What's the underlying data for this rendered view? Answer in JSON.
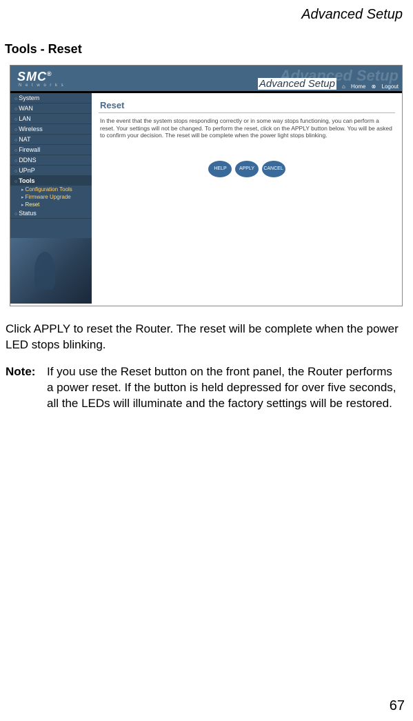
{
  "page": {
    "running_header": "Advanced Setup",
    "section_title": "Tools - Reset",
    "body_paragraph": "Click APPLY to reset the Router. The reset will be complete when the power LED stops blinking.",
    "note_label": "Note:",
    "note_text": "If you use the Reset button on the front panel, the Router performs a power reset. If the button is held depressed for over five seconds, all the LEDs will illuminate and the factory settings will be restored.",
    "page_number": "67"
  },
  "router_ui": {
    "logo_text": "SMC",
    "logo_reg": "®",
    "logo_sub": "N e t w o r k s",
    "banner_label": "Advanced Setup",
    "banner_ghost": "Advanced Setup",
    "header_links": {
      "home": "Home",
      "logout": "Logout"
    },
    "nav": [
      "System",
      "WAN",
      "LAN",
      "Wireless",
      "NAT",
      "Firewall",
      "DDNS",
      "UPnP"
    ],
    "nav_group": "Tools",
    "nav_sub": [
      "Configuration Tools",
      "Firmware Upgrade",
      "Reset"
    ],
    "nav_after": [
      "Status"
    ],
    "content": {
      "title": "Reset",
      "desc": "In the event that the system stops responding correctly or in some way stops functioning, you can perform a reset. Your settings will not be changed. To perform the reset, click on the APPLY button below. You will be asked to confirm your decision. The reset will be complete when the power light stops blinking."
    },
    "buttons": {
      "help": "HELP",
      "apply": "APPLY",
      "cancel": "CANCEL"
    }
  }
}
